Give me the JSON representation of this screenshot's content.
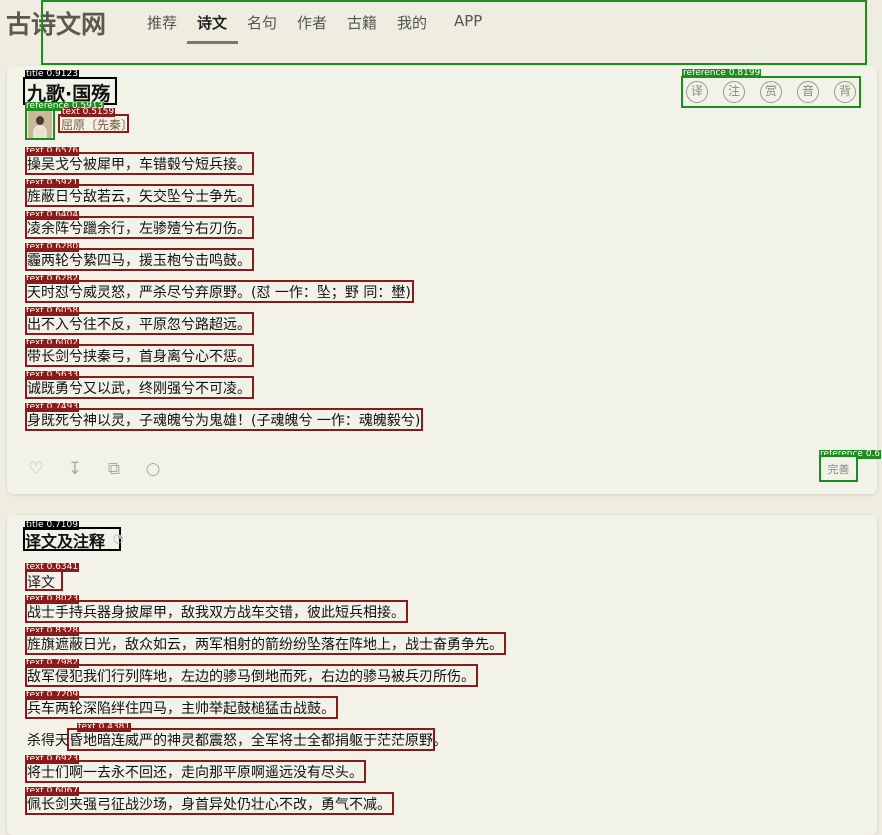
{
  "header": {
    "logo": "古诗文网",
    "nav": [
      {
        "label": "推荐",
        "active": false
      },
      {
        "label": "诗文",
        "active": true
      },
      {
        "label": "名句",
        "active": false
      },
      {
        "label": "作者",
        "active": false
      },
      {
        "label": "古籍",
        "active": false
      },
      {
        "label": "我的",
        "active": false
      },
      {
        "label": "APP",
        "active": false
      }
    ]
  },
  "overlay": {
    "title1": "title 0.9123",
    "ref_author": "reference 0.5913",
    "ref_tools": "reference 0.8199",
    "ref_perfect": "reference 0.6",
    "text_author": "text 0.5159",
    "title2": "title 0.7109",
    "poem_scores": [
      "text 0.6576",
      "text 0.5921",
      "text 0.6404",
      "text 0.6280",
      "text 0.6282",
      "text 0.6058",
      "text 0.6002",
      "text 0.5633",
      "text 0.7493"
    ],
    "tr_scores": [
      "text 0.6341",
      "text 0.8023",
      "text 0.8328",
      "text 0.7982",
      "text 0.7209",
      "text 0.4381",
      "text 0.6923",
      "text 0.6067"
    ]
  },
  "poem": {
    "title": "九歌·国殇",
    "author": "屈原〔先秦〕",
    "lines": [
      "操吴戈兮被犀甲，车错毂兮短兵接。",
      "旌蔽日兮敌若云，矢交坠兮士争先。",
      "凌余阵兮躐余行，左骖殪兮右刃伤。",
      "霾两轮兮絷四马，援玉枹兮击鸣鼓。",
      "天时怼兮威灵怒，严杀尽兮弃原野。(怼 一作：坠；野 同：壄)",
      "出不入兮往不反，平原忽兮路超远。",
      "带长剑兮挟秦弓，首身离兮心不惩。",
      "诚既勇兮又以武，终刚强兮不可凌。",
      "身既死兮神以灵，子魂魄兮为鬼雄！(子魂魄兮 一作：魂魄毅兮)"
    ],
    "tools": [
      "译",
      "注",
      "赏",
      "音",
      "背"
    ],
    "actions": [
      "heart-icon",
      "download-icon",
      "copy-icon",
      "audio-icon"
    ],
    "perfect_label": "完善"
  },
  "translation": {
    "title": "译文及注释",
    "label": "译文",
    "lines": [
      "战士手持兵器身披犀甲，敌我双方战车交错，彼此短兵相接。",
      "旌旗遮蔽日光，敌众如云，两军相射的箭纷纷坠落在阵地上，战士奋勇争先。",
      "敌军侵犯我们行列阵地，左边的骖马倒地而死，右边的骖马被兵刃所伤。",
      "兵车两轮深陷绊住四马，主帅举起鼓槌猛击战鼓。",
      "杀得天昏地暗连威严的神灵都震怒，全军将士全都捐躯于茫茫原野。",
      "将士们啊一去永不回还，走向那平原啊遥远没有尽头。",
      "佩长剑夹强弓征战沙场，身首异处仍壮心不改，勇气不减。"
    ]
  }
}
